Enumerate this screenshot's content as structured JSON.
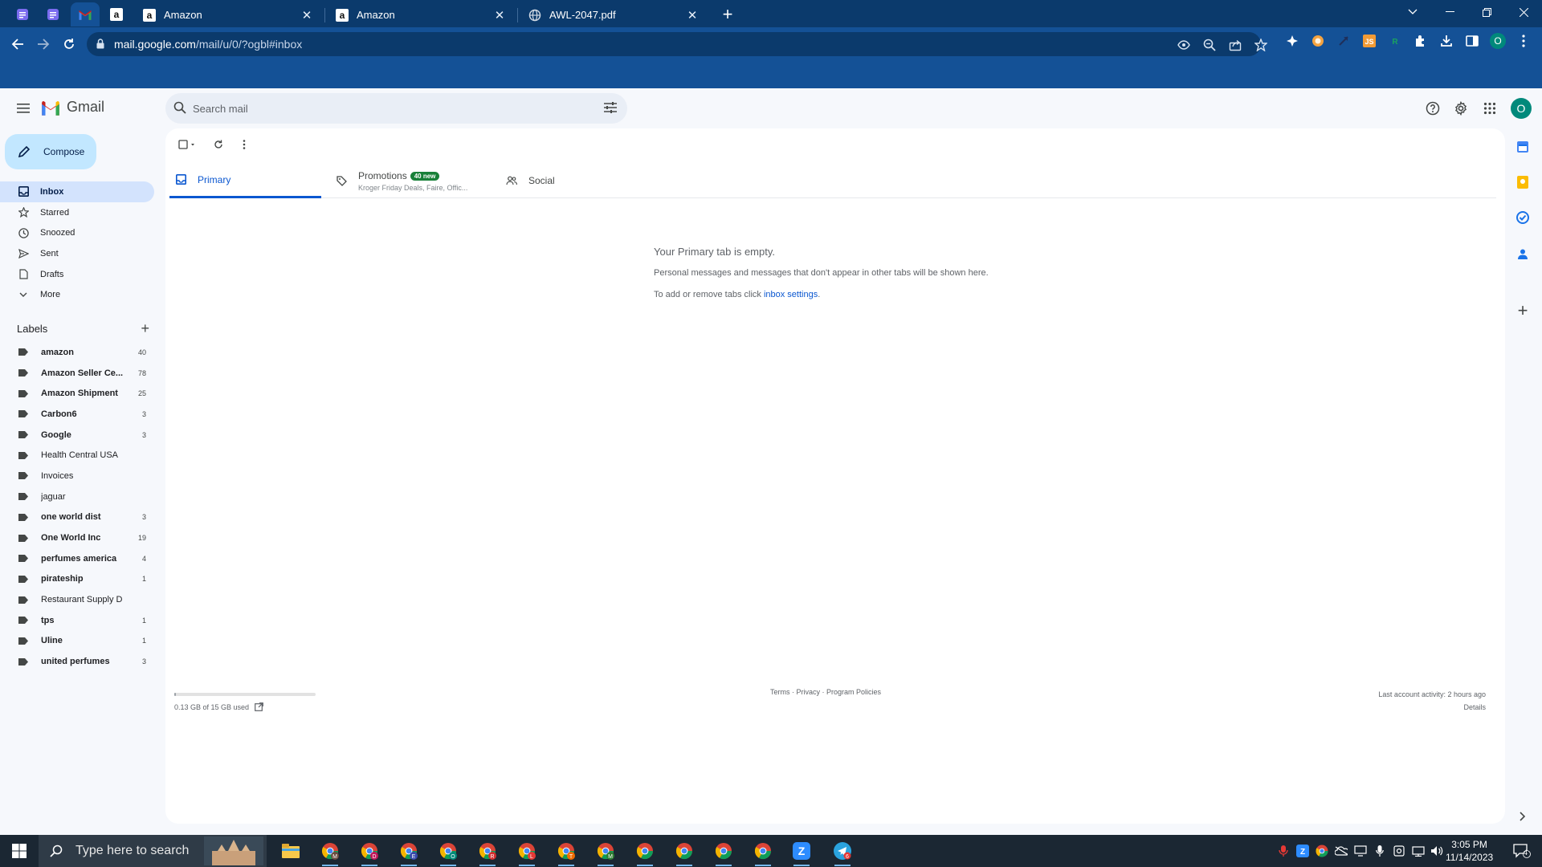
{
  "browser": {
    "tabs": [
      {
        "title": "Amazon",
        "icon": "amazon-icon"
      },
      {
        "title": "Amazon",
        "icon": "amazon-icon"
      },
      {
        "title": "AWL-2047.pdf",
        "icon": "globe-icon"
      }
    ],
    "url_host": "mail.google.com",
    "url_path": "/mail/u/0/?ogbl#inbox"
  },
  "gmail": {
    "product_name": "Gmail",
    "search_placeholder": "Search mail",
    "avatar_letter": "O",
    "compose_label": "Compose",
    "nav": [
      "Inbox",
      "Starred",
      "Snoozed",
      "Sent",
      "Drafts",
      "More"
    ],
    "labels_heading": "Labels",
    "labels": [
      {
        "name": "amazon",
        "count": "40",
        "bold": true
      },
      {
        "name": "Amazon Seller Ce...",
        "count": "78",
        "bold": true
      },
      {
        "name": "Amazon Shipment",
        "count": "25",
        "bold": true
      },
      {
        "name": "Carbon6",
        "count": "3",
        "bold": true
      },
      {
        "name": "Google",
        "count": "3",
        "bold": true
      },
      {
        "name": "Health Central USA",
        "count": "",
        "bold": false
      },
      {
        "name": "Invoices",
        "count": "",
        "bold": false
      },
      {
        "name": "jaguar",
        "count": "",
        "bold": false
      },
      {
        "name": "one world dist",
        "count": "3",
        "bold": true
      },
      {
        "name": "One World Inc",
        "count": "19",
        "bold": true
      },
      {
        "name": "perfumes america",
        "count": "4",
        "bold": true
      },
      {
        "name": "pirateship",
        "count": "1",
        "bold": true
      },
      {
        "name": "Restaurant Supply D",
        "count": "",
        "bold": false
      },
      {
        "name": "tps",
        "count": "1",
        "bold": true
      },
      {
        "name": "Uline",
        "count": "1",
        "bold": true
      },
      {
        "name": "united perfumes",
        "count": "3",
        "bold": true
      }
    ],
    "inbox_tabs": {
      "primary": "Primary",
      "promotions": "Promotions",
      "promotions_badge": "40 new",
      "promotions_sub": "Kroger Friday Deals, Faire, Offic...",
      "social": "Social"
    },
    "empty": {
      "title": "Your Primary tab is empty.",
      "line1": "Personal messages and messages that don't appear in other tabs will be shown here.",
      "line2_prefix": "To add or remove tabs click ",
      "line2_link": "inbox settings",
      "line2_suffix": "."
    },
    "storage_text": "0.13 GB of 15 GB used",
    "storage_used_fraction": 0.009,
    "footer_links": "Terms · Privacy · Program Policies",
    "last_activity": "Last account activity: 2 hours ago",
    "details": "Details"
  },
  "taskbar": {
    "search_placeholder": "Type here to search",
    "time": "3:05 PM",
    "date": "11/14/2023",
    "notifications": "4",
    "chrome_profile_letters": [
      "M",
      "D",
      "E",
      "O",
      "R",
      "L",
      "T",
      "M",
      "",
      "",
      "",
      ""
    ]
  },
  "colors": {
    "chrome_frame": "#0b3a6c",
    "chrome_toolbar": "#145196",
    "gmail_bg": "#f6f8fc",
    "compose_bg": "#c2e7ff",
    "accent": "#0b57d0",
    "badge_green": "#188038"
  }
}
